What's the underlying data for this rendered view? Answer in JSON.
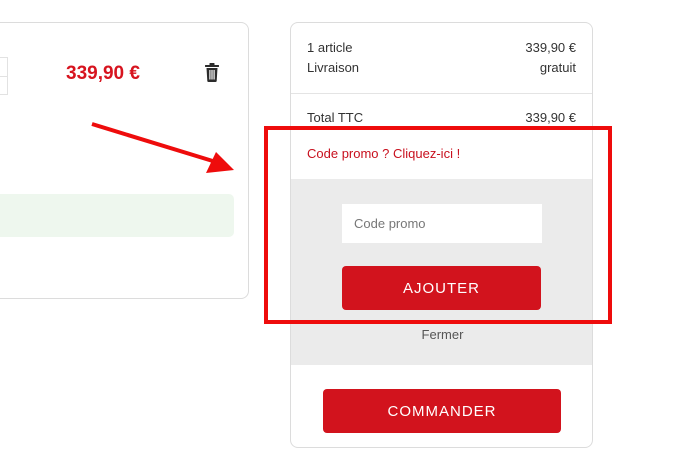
{
  "cart_item": {
    "price": "339,90 €",
    "notice": ""
  },
  "summary": {
    "items_label": "1 article",
    "items_value": "339,90 €",
    "shipping_label": "Livraison",
    "shipping_value": "gratuit",
    "total_label": "Total TTC",
    "total_value": "339,90 €"
  },
  "promo": {
    "link_label": "Code promo ? Cliquez-ici !",
    "input_placeholder": "Code promo",
    "input_value": "",
    "add_label": "AJOUTER",
    "close_label": "Fermer"
  },
  "checkout": {
    "order_label": "COMMANDER"
  },
  "annotations": {
    "color": "#ee0c0c"
  },
  "colors": {
    "brand_red": "#d2131d",
    "price_red": "#d7141f",
    "panel_gray": "#ebebeb",
    "notice_green": "#eef7ee"
  },
  "icons": {
    "delete": "trash-icon",
    "pointer": "arrow-annotation"
  }
}
